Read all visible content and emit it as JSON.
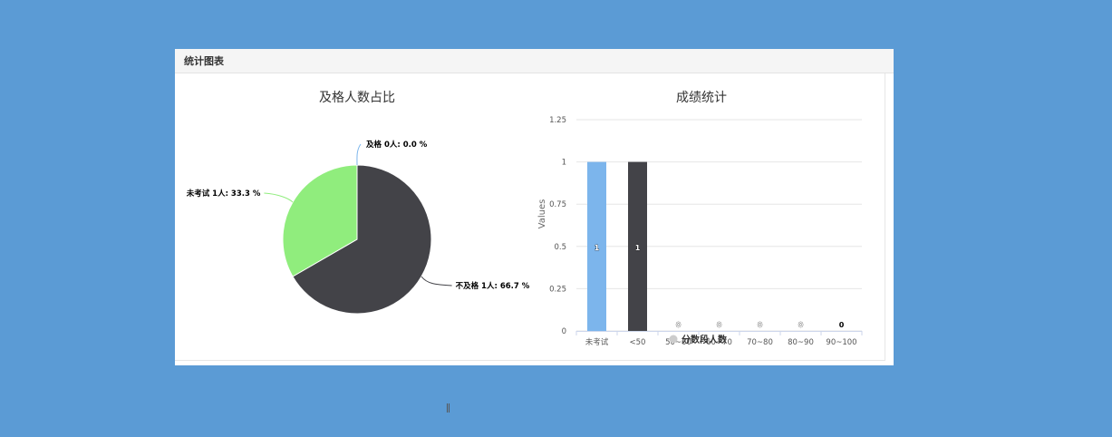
{
  "panel": {
    "title": "统计图表"
  },
  "chart_data": [
    {
      "type": "pie",
      "title": "及格人数占比",
      "slices": [
        {
          "name": "及格",
          "value": 0,
          "label": "及格 0人: 0.0 %",
          "color": "#7cb5ec"
        },
        {
          "name": "不及格",
          "value": 2,
          "label": "不及格 1人: 66.7 %",
          "color": "#434348"
        },
        {
          "name": "未考试",
          "value": 1,
          "label": "未考试 1人: 33.3 %",
          "color": "#90ed7d"
        }
      ]
    },
    {
      "type": "bar",
      "title": "成绩统计",
      "ylabel": "Values",
      "xlabel": "",
      "ylim": [
        0,
        1.25
      ],
      "yticks": [
        "0",
        "0.25",
        "0.5",
        "0.75",
        "1",
        "1.25"
      ],
      "categories": [
        "未考试",
        "<50",
        "50~60",
        "60~70",
        "70~80",
        "80~90",
        "90~100"
      ],
      "series": [
        {
          "name": "分数段人数",
          "values": [
            1,
            1,
            0,
            0,
            0,
            0,
            0
          ],
          "colors": [
            "#7cb5ec",
            "#434348",
            "#90ed7d",
            "#f7a35c",
            "#8085e9",
            "#f15c80",
            "#e4d354"
          ]
        }
      ],
      "data_labels": [
        "1",
        "1",
        "0",
        "0",
        "0",
        "0",
        "0"
      ],
      "legend_color": "#cccccc",
      "legend_position": "bottom-center"
    }
  ]
}
